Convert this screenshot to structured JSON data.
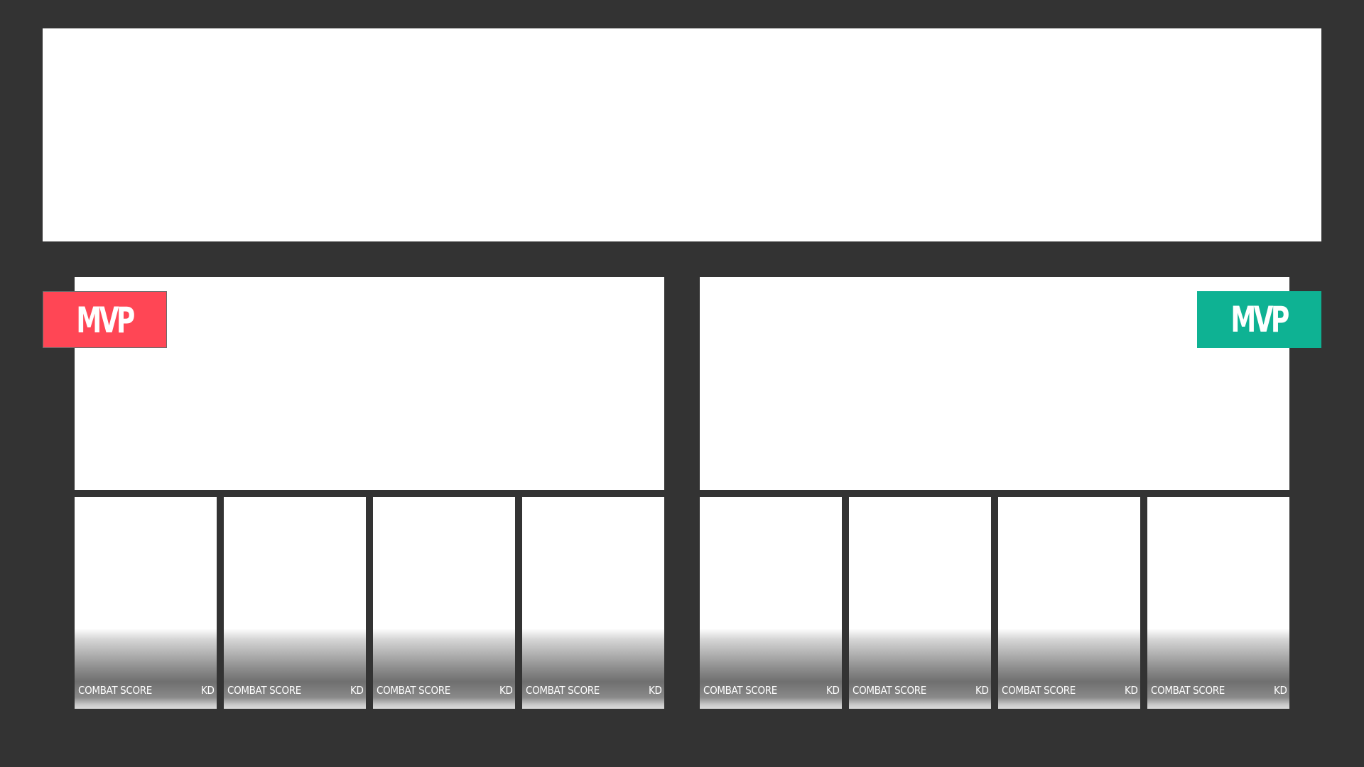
{
  "colors": {
    "background": "#333333",
    "panel": "#ffffff",
    "team_left_accent": "#ff4655",
    "team_right_accent": "#0eb293",
    "label_text": "#ffffff"
  },
  "teams": [
    {
      "side": "left",
      "mvp_label": "MVP",
      "players": [
        {
          "combat_label": "COMBAT SCORE",
          "kd_label": "KD"
        },
        {
          "combat_label": "COMBAT SCORE",
          "kd_label": "KD"
        },
        {
          "combat_label": "COMBAT SCORE",
          "kd_label": "KD"
        },
        {
          "combat_label": "COMBAT SCORE",
          "kd_label": "KD"
        }
      ]
    },
    {
      "side": "right",
      "mvp_label": "MVP",
      "players": [
        {
          "combat_label": "COMBAT SCORE",
          "kd_label": "KD"
        },
        {
          "combat_label": "COMBAT SCORE",
          "kd_label": "KD"
        },
        {
          "combat_label": "COMBAT SCORE",
          "kd_label": "KD"
        },
        {
          "combat_label": "COMBAT SCORE",
          "kd_label": "KD"
        }
      ]
    }
  ]
}
